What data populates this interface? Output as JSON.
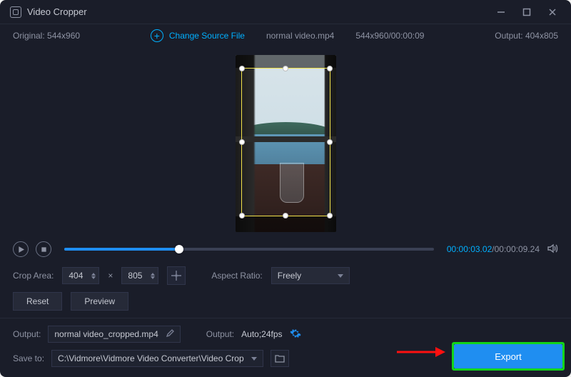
{
  "titlebar": {
    "title": "Video Cropper"
  },
  "infobar": {
    "original_label": "Original:",
    "original_dims": "544x960",
    "change_source": "Change Source File",
    "filename": "normal video.mp4",
    "file_dims_time": "544x960/00:00:09",
    "output_label": "Output:",
    "output_dims": "404x805"
  },
  "playbar": {
    "current_time": "00:00:03.02",
    "total_time": "00:00:09.24"
  },
  "controls": {
    "crop_area_label": "Crop Area:",
    "width": "404",
    "height": "805",
    "aspect_label": "Aspect Ratio:",
    "aspect_value": "Freely",
    "reset": "Reset",
    "preview": "Preview"
  },
  "bottom": {
    "output_label": "Output:",
    "output_filename": "normal video_cropped.mp4",
    "output2_label": "Output:",
    "output2_value": "Auto;24fps",
    "save_label": "Save to:",
    "save_path": "C:\\Vidmore\\Vidmore Video Converter\\Video Crop",
    "export": "Export"
  }
}
